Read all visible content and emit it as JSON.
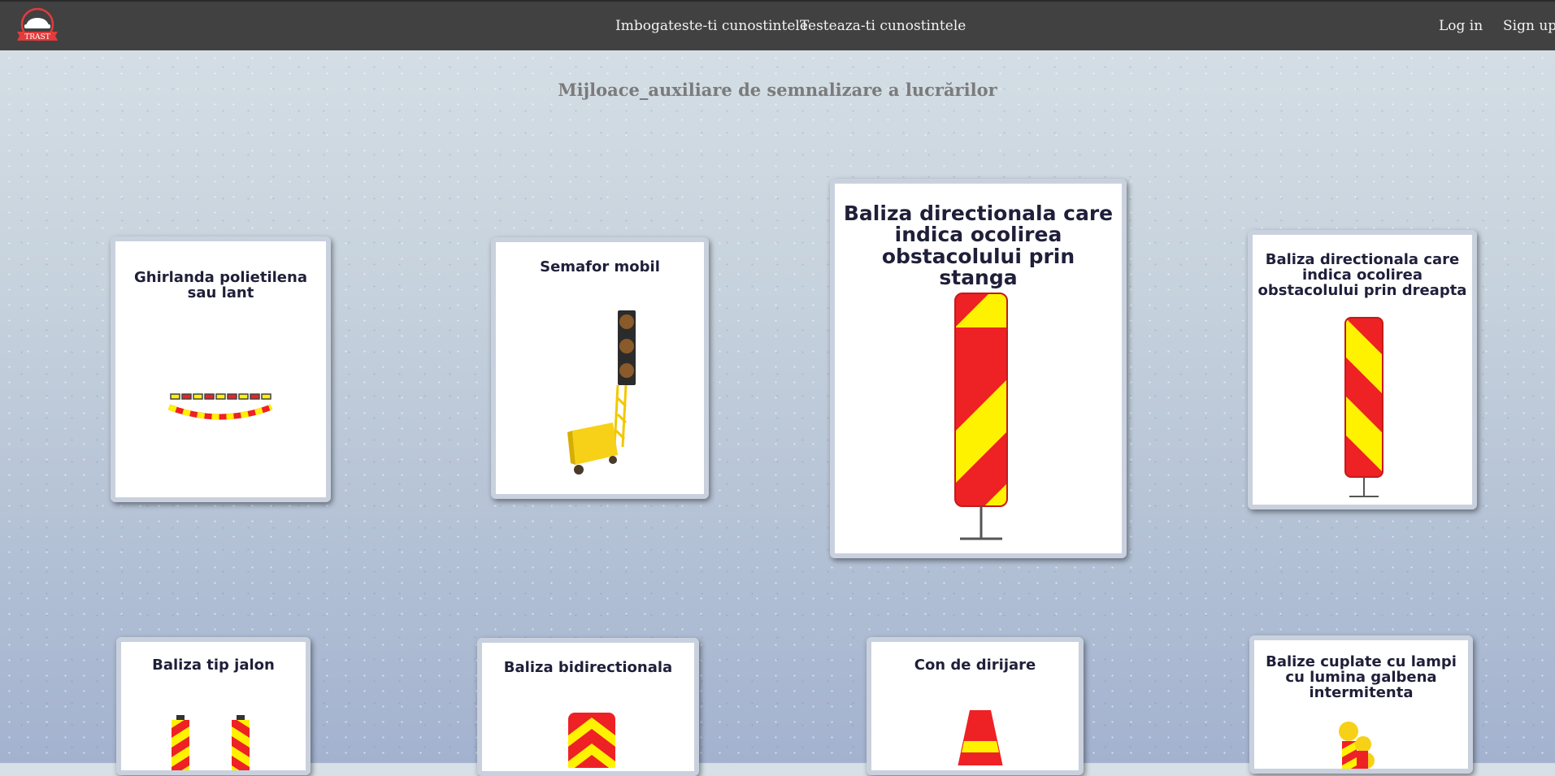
{
  "nav": {
    "logo_text": "TRAST",
    "link_learn": "Imbogateste-ti cunostintele",
    "link_test": "Testeaza-ti cunostintele",
    "login": "Log in",
    "signup": "Sign up"
  },
  "page": {
    "title": "Mijloace_auxiliare de semnalizare a lucrărilor"
  },
  "cards": [
    {
      "title": "Ghirlanda polietilena sau lant",
      "image": "garland-chain-icon"
    },
    {
      "title": "Semafor mobil",
      "image": "mobile-traffic-light-icon"
    },
    {
      "title": "Baliza directionala care indica ocolirea obstacolului prin stanga",
      "image": "left-directional-beacon-icon"
    },
    {
      "title": "Baliza directionala care indica ocolirea obstacolului prin dreapta",
      "image": "right-directional-beacon-icon"
    },
    {
      "title": "Baliza tip jalon",
      "image": "marker-beacon-icon"
    },
    {
      "title": "Baliza bidirectionala",
      "image": "bidirectional-beacon-icon"
    },
    {
      "title": "Con de dirijare",
      "image": "traffic-cone-icon"
    },
    {
      "title": "Balize cuplate cu lampi cu lumina galbena intermitenta",
      "image": "coupled-beacons-lamp-icon"
    }
  ],
  "colors": {
    "navbar": "#414141",
    "stripe_red": "#ee2125",
    "stripe_yellow": "#fff200",
    "title_text": "#1f1f3a"
  }
}
